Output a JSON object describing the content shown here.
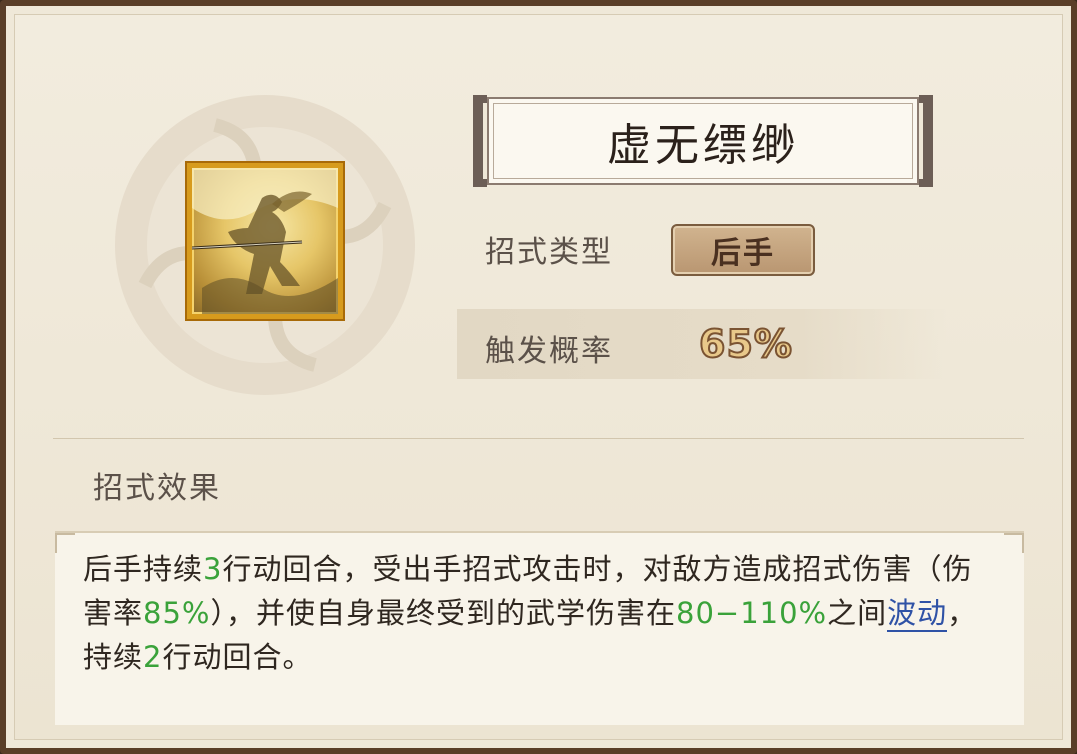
{
  "skill": {
    "name": "虚无缥缈",
    "type_label": "招式类型",
    "type_value": "后手",
    "prob_label": "触发概率",
    "prob_value": "65%",
    "section_label": "招式效果",
    "icon_name": "skill-portrait-icon"
  },
  "description": {
    "p1": "后手持续",
    "v1": "3",
    "p2": "行动回合，受出手招式攻击时，对敌方造成招式伤害（伤害率",
    "v2": "85%",
    "p3": "），并使自身最终受到的武学伤害在",
    "v3": "80−110%",
    "p4": "之间",
    "link": "波动",
    "p5": "，持续",
    "v4": "2",
    "p6": "行动回合。"
  },
  "colors": {
    "value_green": "#3aa23a",
    "link_blue": "#2f52a6",
    "badge_bg": "#c4a57f",
    "icon_border": "#d79b1d"
  }
}
